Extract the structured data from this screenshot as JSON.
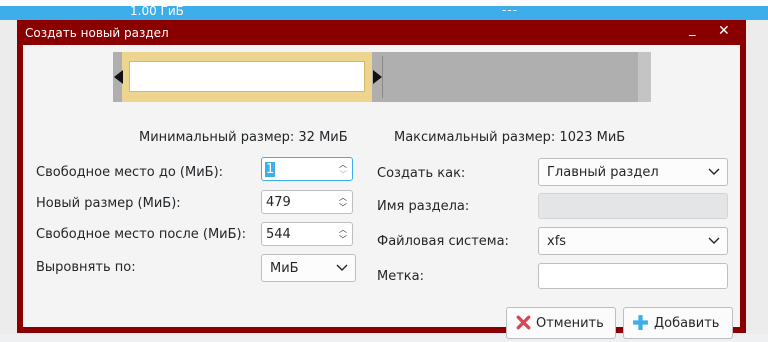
{
  "background": {
    "row_size": "1.00 ГиБ",
    "row_dashes": "---"
  },
  "dialog": {
    "title": "Создать новый раздел"
  },
  "partition_visual": {
    "min_size_label": "Минимальный размер: 32 МиБ",
    "max_size_label": "Максимальный размер: 1023 МиБ"
  },
  "size": {
    "free_before_label": "Свободное место до (МиБ):",
    "free_before_value": "1",
    "new_size_label": "Новый размер (МиБ):",
    "new_size_value": "479",
    "free_after_label": "Свободное место после (МиБ):",
    "free_after_value": "544",
    "align_label": "Выровнять по:",
    "align_value": "МиБ"
  },
  "options": {
    "create_as_label": "Создать как:",
    "create_as_value": "Главный раздел",
    "partition_name_label": "Имя раздела:",
    "partition_name_value": "",
    "filesystem_label": "Файловая система:",
    "filesystem_value": "xfs",
    "label_label": "Метка:",
    "label_value": ""
  },
  "buttons": {
    "cancel": "Отменить",
    "add": "Добавить"
  },
  "colors": {
    "title_bar": "#8a0000",
    "selection": "#3daee9",
    "partition_fill": "#eed58f",
    "unallocated": "#afafaf",
    "cancel_icon": "#da4453",
    "add_icon": "#3daee9"
  }
}
